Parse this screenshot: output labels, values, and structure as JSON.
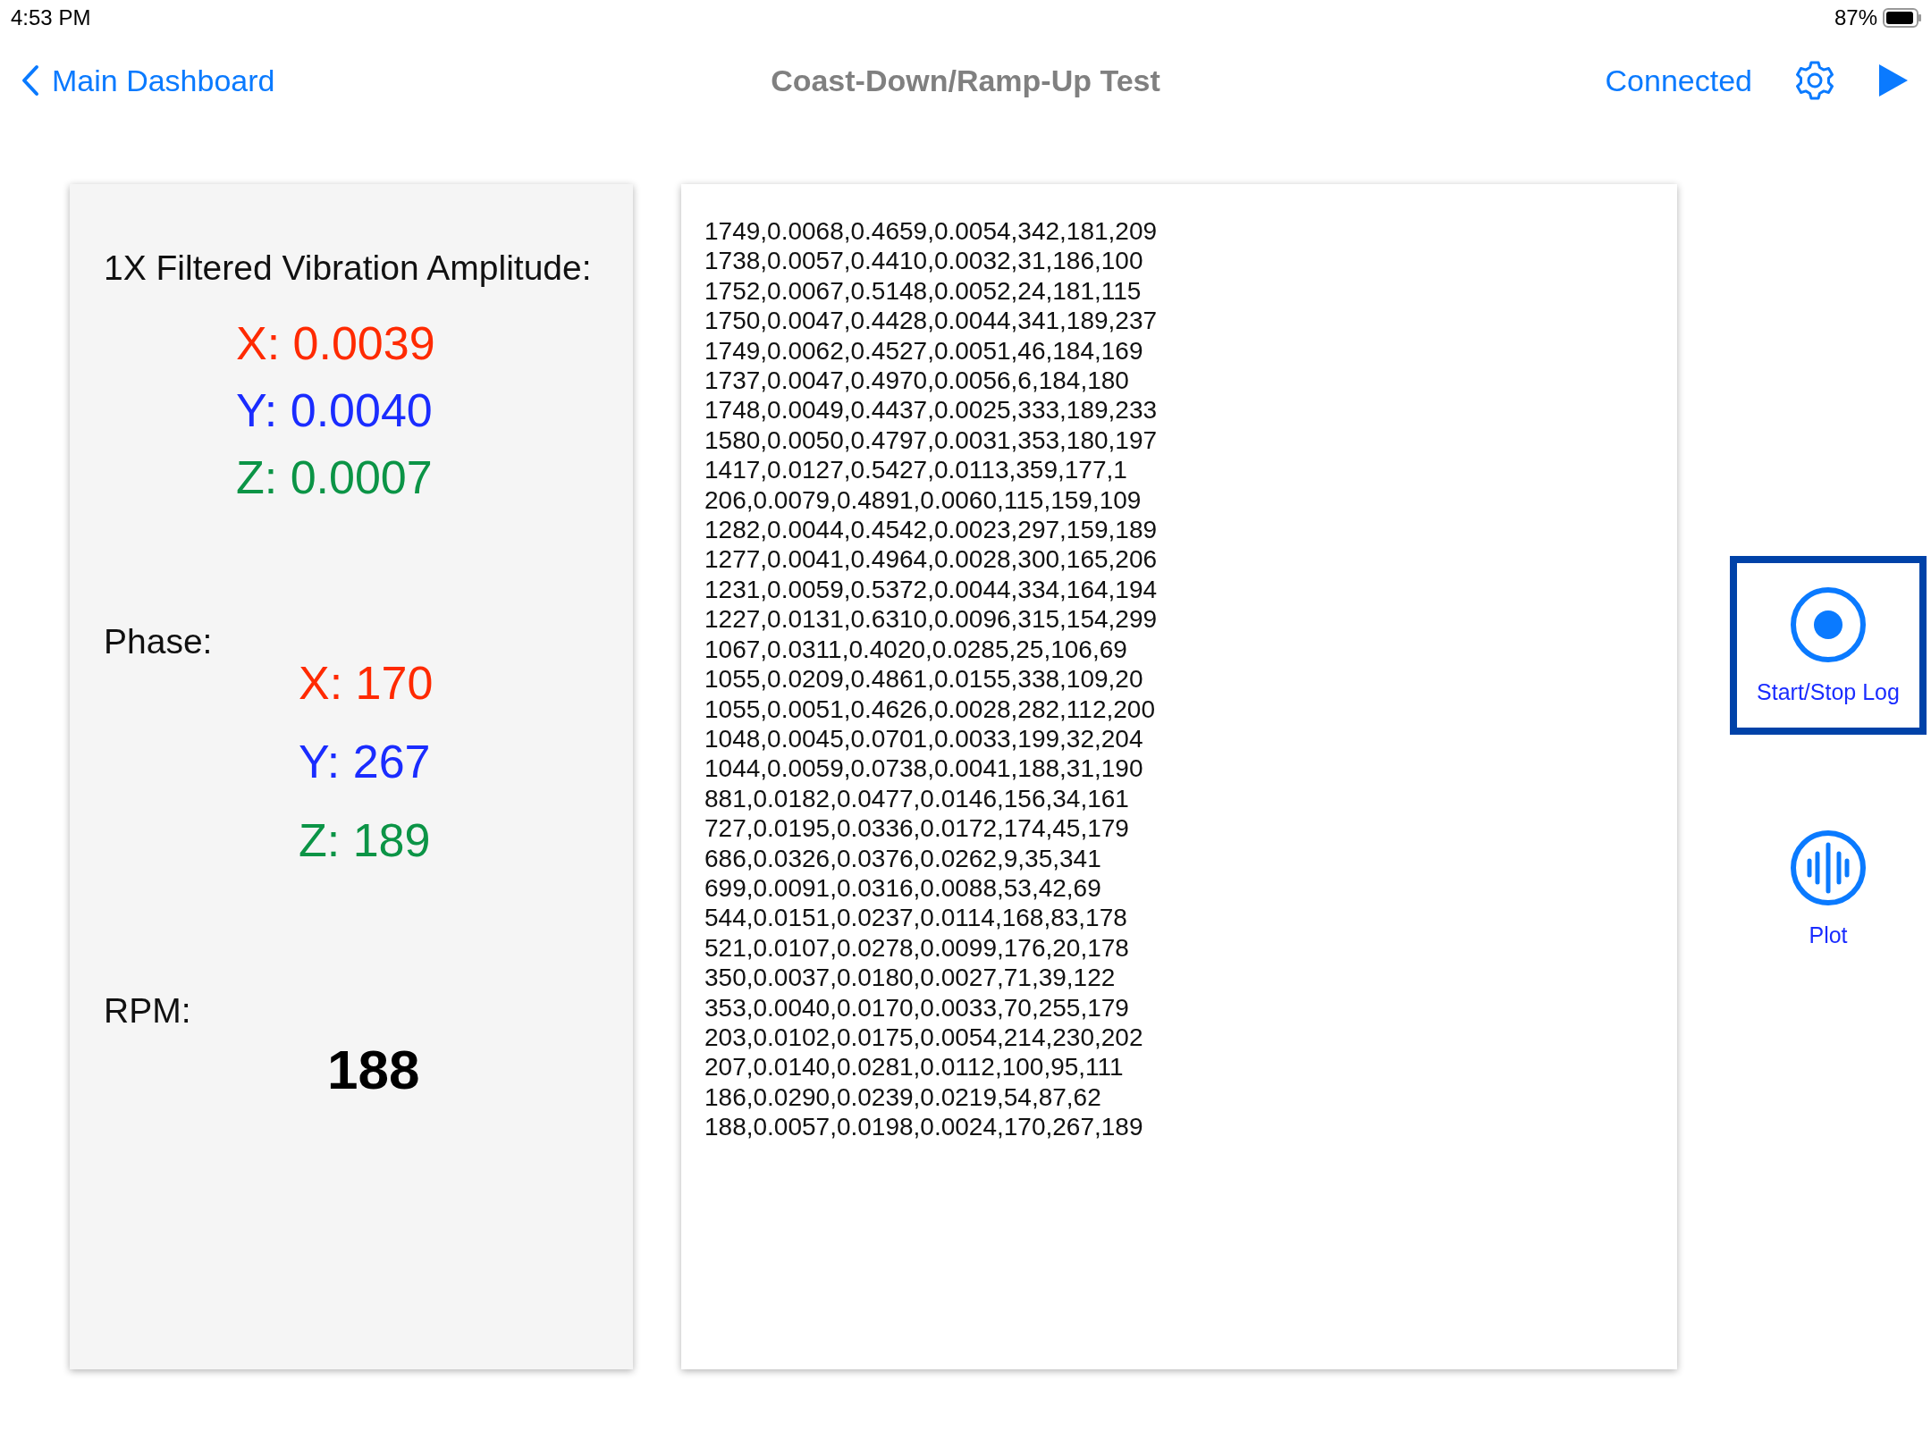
{
  "status_bar": {
    "time": "4:53 PM",
    "battery": "87%"
  },
  "nav": {
    "back": "Main Dashboard",
    "title": "Coast-Down/Ramp-Up Test",
    "status": "Connected"
  },
  "amplitude": {
    "heading": "1X Filtered Vibration Amplitude:",
    "values": [
      {
        "text": "X: 0.0039",
        "color": "#ff2a00"
      },
      {
        "text": "Y: 0.0040",
        "color": "#1a2cff"
      },
      {
        "text": "Z: 0.0007",
        "color": "#0b9446"
      }
    ]
  },
  "phase": {
    "label": "Phase:",
    "values": [
      {
        "text": "X: 170",
        "color": "#ff2a00"
      },
      {
        "text": "Y: 267",
        "color": "#1a2cff"
      },
      {
        "text": "Z: 189",
        "color": "#0b9446"
      }
    ]
  },
  "rpm": {
    "label": "RPM:",
    "value": "188"
  },
  "log": {
    "lines": [
      "1749,0.0068,0.4659,0.0054,342,181,209",
      "1738,0.0057,0.4410,0.0032,31,186,100",
      "1752,0.0067,0.5148,0.0052,24,181,115",
      "1750,0.0047,0.4428,0.0044,341,189,237",
      "1749,0.0062,0.4527,0.0051,46,184,169",
      "1737,0.0047,0.4970,0.0056,6,184,180",
      "1748,0.0049,0.4437,0.0025,333,189,233",
      "1580,0.0050,0.4797,0.0031,353,180,197",
      "1417,0.0127,0.5427,0.0113,359,177,1",
      "206,0.0079,0.4891,0.0060,115,159,109",
      "1282,0.0044,0.4542,0.0023,297,159,189",
      "1277,0.0041,0.4964,0.0028,300,165,206",
      "1231,0.0059,0.5372,0.0044,334,164,194",
      "1227,0.0131,0.6310,0.0096,315,154,299",
      "1067,0.0311,0.4020,0.0285,25,106,69",
      "1055,0.0209,0.4861,0.0155,338,109,20",
      "1055,0.0051,0.4626,0.0028,282,112,200",
      "1048,0.0045,0.0701,0.0033,199,32,204",
      "1044,0.0059,0.0738,0.0041,188,31,190",
      "881,0.0182,0.0477,0.0146,156,34,161",
      "727,0.0195,0.0336,0.0172,174,45,179",
      "686,0.0326,0.0376,0.0262,9,35,341",
      "699,0.0091,0.0316,0.0088,53,42,69",
      "544,0.0151,0.0237,0.0114,168,83,178",
      "521,0.0107,0.0278,0.0099,176,20,178",
      "350,0.0037,0.0180,0.0027,71,39,122",
      "353,0.0040,0.0170,0.0033,70,255,179",
      "203,0.0102,0.0175,0.0054,214,230,202",
      "207,0.0140,0.0281,0.0112,100,95,111",
      "186,0.0290,0.0239,0.0219,54,87,62",
      "188,0.0057,0.0198,0.0024,170,267,189"
    ]
  },
  "actions": [
    {
      "kind": "record",
      "label": "Start/Stop Log",
      "selected": true
    },
    {
      "kind": "waveform",
      "label": "Plot",
      "selected": false
    }
  ]
}
